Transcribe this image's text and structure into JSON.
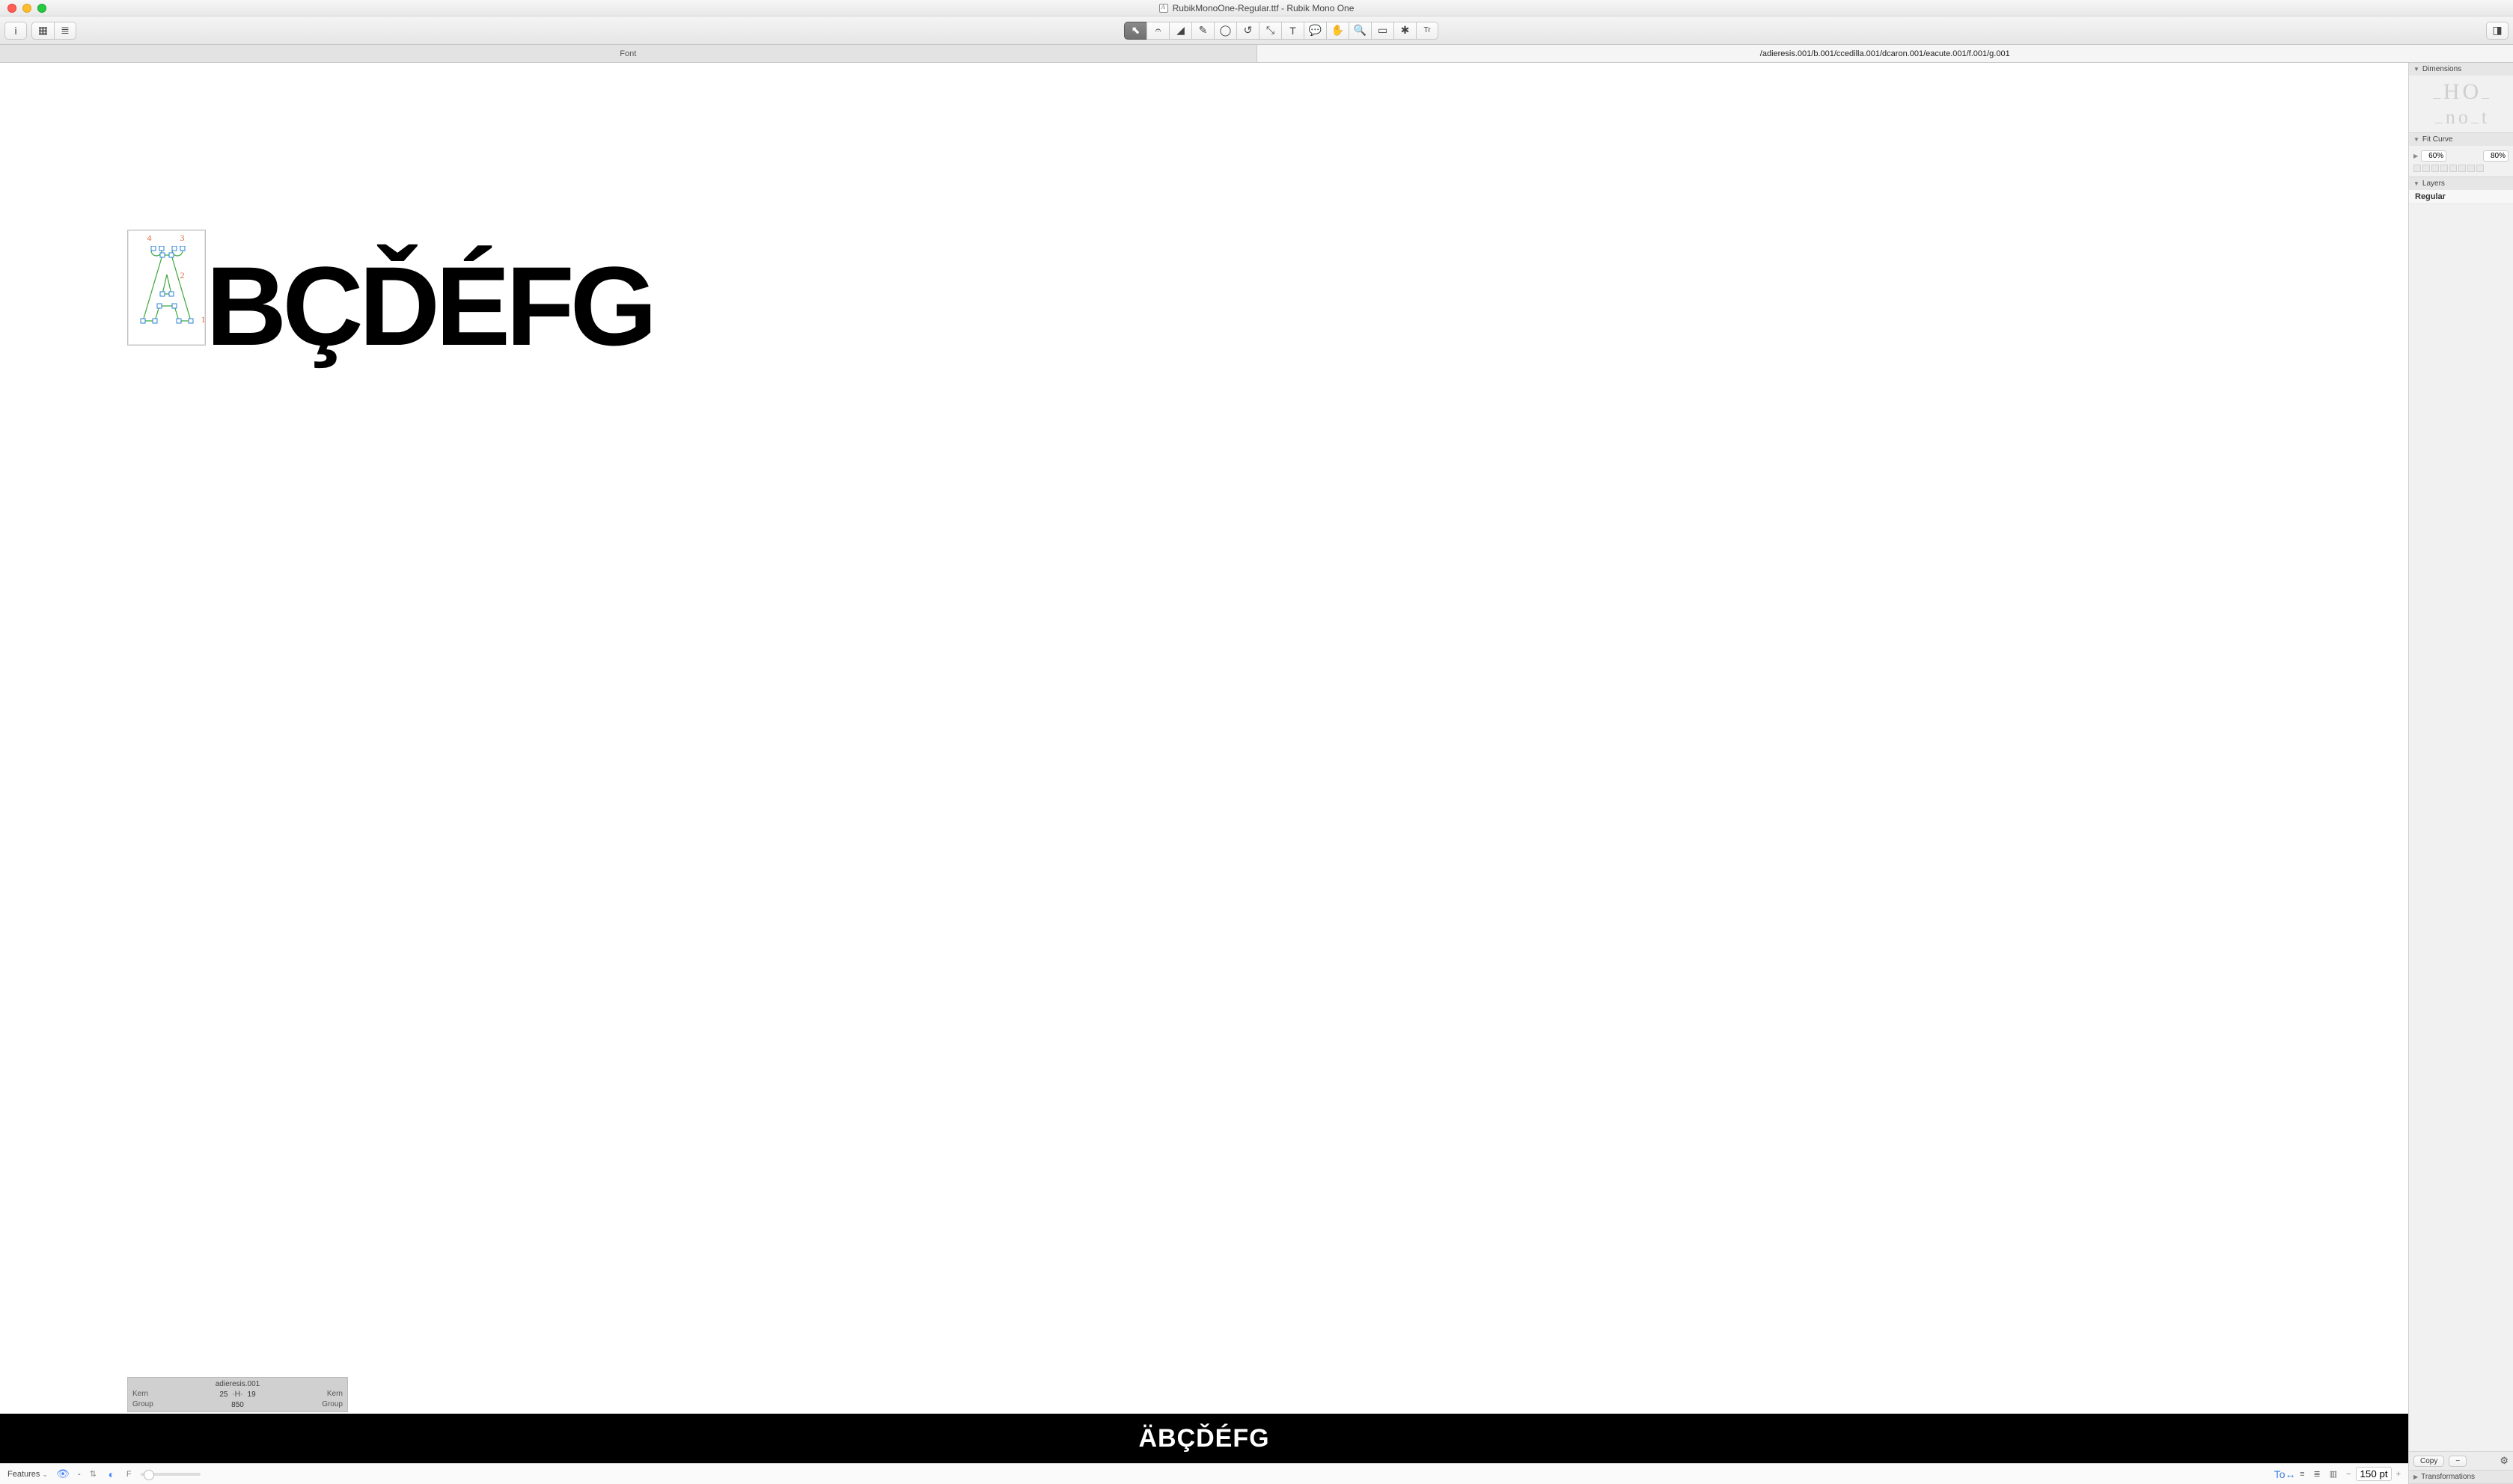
{
  "window": {
    "title": "RubikMonoOne-Regular.ttf - Rubik Mono One"
  },
  "tabs": {
    "font": "Font",
    "glyph_path": "/adieresis.001/b.001/ccedilla.001/dcaron.001/eacute.001/f.001/g.001"
  },
  "sidebar": {
    "dimensions_title": "Dimensions",
    "dim_caps": [
      "H",
      "O"
    ],
    "dim_xheight": [
      "n",
      "o",
      "t"
    ],
    "fit_title": "Fit Curve",
    "fit_min": "60%",
    "fit_max": "80%",
    "layers_title": "Layers",
    "layer_name": "Regular",
    "copy_label": "Copy",
    "minus_label": "−",
    "transformations_title": "Transformations"
  },
  "canvas": {
    "selected_glyph": "adieresis.001",
    "big_rest": "BÇĎÉFG",
    "points": {
      "p1": "1",
      "p2": "2",
      "p3": "3",
      "p4": "4"
    }
  },
  "infobox": {
    "glyph_name": "adieresis.001",
    "kern_left_label": "Kern",
    "kern_right_label": "Kern",
    "group_left_label": "Group",
    "group_right_label": "Group",
    "lsb": "25",
    "rsb": "19",
    "advance": "850"
  },
  "preview": {
    "text": "ÄBÇĎÉFG"
  },
  "bottombar": {
    "features_label": "Features",
    "dash": "-",
    "f_label": "F",
    "zoom_value": "150 pt"
  }
}
